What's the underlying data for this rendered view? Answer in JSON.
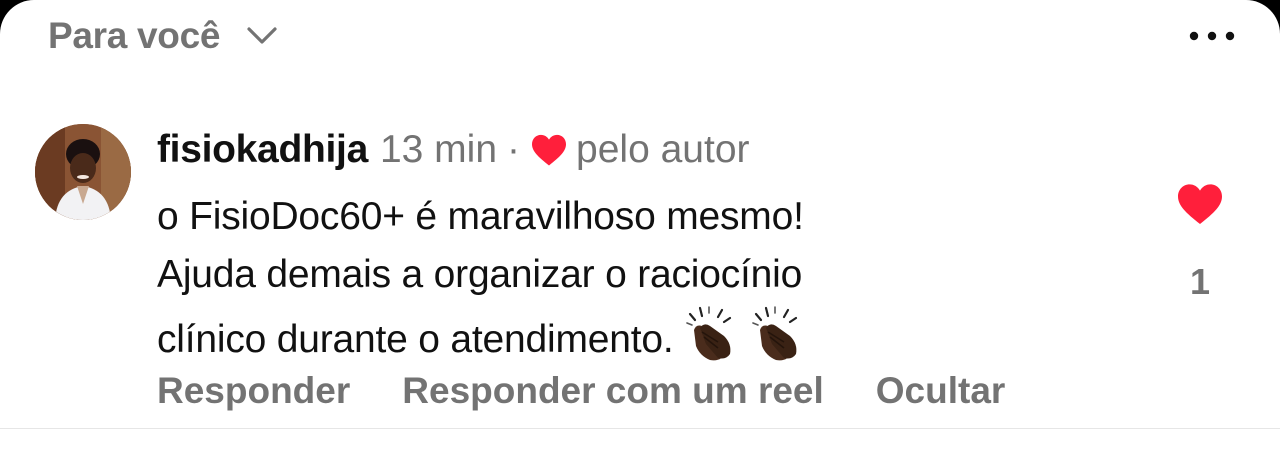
{
  "header": {
    "title": "Para você",
    "chevron_icon": "chevron-down-icon",
    "menu_icon": "more-horizontal-icon"
  },
  "comment": {
    "username": "fisiokadhija",
    "time": "13 min",
    "separator": "·",
    "liked_by_author_icon": "heart-icon",
    "liked_by_author_label": "pelo autor",
    "line1": "o FisioDoc60+ é maravilhoso mesmo!",
    "line2": "Ajuda demais a organizar o raciocínio",
    "line3": "clínico durante o atendimento.",
    "emojis": [
      "clapping-hands-icon",
      "clapping-hands-icon"
    ],
    "like_count": "1"
  },
  "actions": {
    "reply": "Responder",
    "reply_reel": "Responder com um reel",
    "hide": "Ocultar"
  },
  "colors": {
    "heart": "#ff1f3b",
    "secondary_text": "#737373",
    "primary_text": "#111111"
  }
}
